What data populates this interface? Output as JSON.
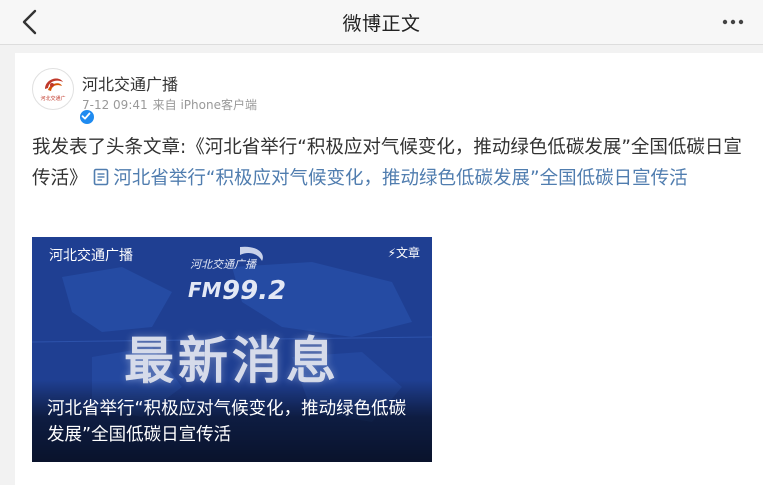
{
  "nav": {
    "title": "微博正文"
  },
  "post": {
    "author": {
      "name": "河北交通广播",
      "avatar_caption": "河北交通广"
    },
    "meta": {
      "time": "7-12 09:41",
      "source": "来自 iPhone客户端"
    },
    "text_prefix": "我发表了头条文章:《河北省举行“积极应对气候变化，推动绿色低碳发展”全国低碳日宣传活》",
    "link_text": "河北省举行“积极应对气候变化，推动绿色低碳发展”全国低碳日宣传活"
  },
  "article_card": {
    "source": "河北交通广播",
    "type_label": "⚡文章",
    "logo_text": "河北交通广播",
    "logo_fm": "FM",
    "logo_freq": "99.2",
    "headline": "最新消息",
    "title": "河北省举行“积极应对气候变化，推动绿色低碳发展”全国低碳日宣传活"
  },
  "colors": {
    "link": "#507daf",
    "verified": "#1f8bf0",
    "card_bg": "#1d3a87"
  },
  "icons": [
    "back-arrow-icon",
    "more-dots-icon",
    "verified-icon",
    "article-doc-icon"
  ]
}
